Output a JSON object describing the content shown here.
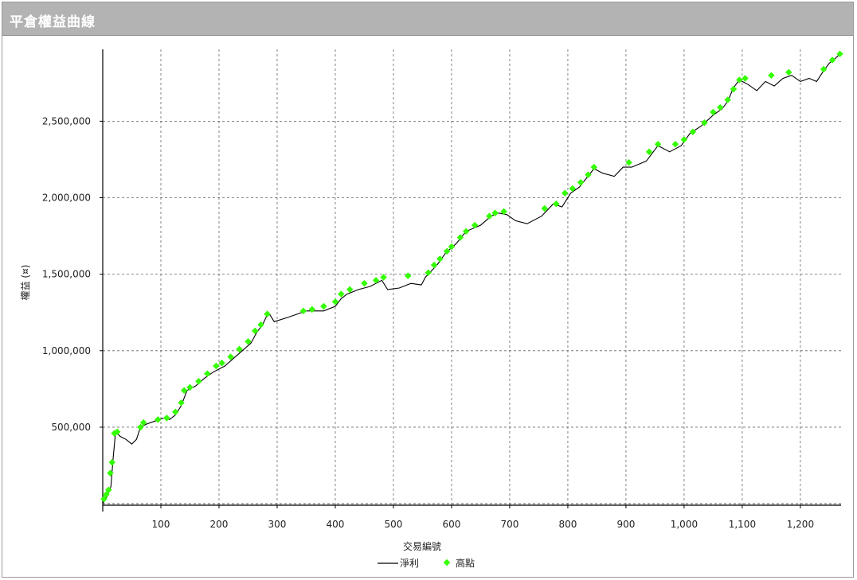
{
  "window": {
    "title": "平倉權益曲線"
  },
  "chart_data": {
    "type": "line",
    "xlabel": "交易編號",
    "ylabel": "權益 (¤)",
    "xlim": [
      0,
      1270
    ],
    "ylim": [
      -10000,
      2970000
    ],
    "x_ticks": [
      100,
      200,
      300,
      400,
      500,
      600,
      700,
      800,
      900,
      1000,
      1100,
      1200
    ],
    "x_tick_labels": [
      "100",
      "200",
      "300",
      "400",
      "500",
      "600",
      "700",
      "800",
      "900",
      "1,000",
      "1,100",
      "1,200"
    ],
    "y_ticks": [
      500000,
      1000000,
      1500000,
      2000000,
      2500000
    ],
    "y_tick_labels": [
      "500,000",
      "1,000,000",
      "1,500,000",
      "2,000,000",
      "2,500,000"
    ],
    "grid": true,
    "legend_position": "bottom-center",
    "series": [
      {
        "name": "淨利",
        "style": "line",
        "color": "#000000",
        "points": [
          [
            0,
            0
          ],
          [
            8,
            50000
          ],
          [
            14,
            110000
          ],
          [
            18,
            300000
          ],
          [
            22,
            470000
          ],
          [
            30,
            440000
          ],
          [
            40,
            420000
          ],
          [
            50,
            390000
          ],
          [
            58,
            420000
          ],
          [
            65,
            500000
          ],
          [
            75,
            520000
          ],
          [
            90,
            540000
          ],
          [
            105,
            560000
          ],
          [
            115,
            550000
          ],
          [
            125,
            580000
          ],
          [
            135,
            640000
          ],
          [
            145,
            740000
          ],
          [
            160,
            770000
          ],
          [
            175,
            820000
          ],
          [
            190,
            860000
          ],
          [
            210,
            900000
          ],
          [
            225,
            950000
          ],
          [
            240,
            1000000
          ],
          [
            255,
            1050000
          ],
          [
            265,
            1120000
          ],
          [
            275,
            1170000
          ],
          [
            285,
            1250000
          ],
          [
            295,
            1190000
          ],
          [
            320,
            1220000
          ],
          [
            350,
            1260000
          ],
          [
            380,
            1260000
          ],
          [
            400,
            1290000
          ],
          [
            410,
            1340000
          ],
          [
            420,
            1370000
          ],
          [
            440,
            1400000
          ],
          [
            460,
            1420000
          ],
          [
            480,
            1460000
          ],
          [
            490,
            1400000
          ],
          [
            510,
            1410000
          ],
          [
            530,
            1440000
          ],
          [
            548,
            1430000
          ],
          [
            555,
            1480000
          ],
          [
            575,
            1560000
          ],
          [
            590,
            1640000
          ],
          [
            608,
            1700000
          ],
          [
            625,
            1780000
          ],
          [
            650,
            1820000
          ],
          [
            668,
            1880000
          ],
          [
            680,
            1900000
          ],
          [
            695,
            1890000
          ],
          [
            710,
            1850000
          ],
          [
            730,
            1830000
          ],
          [
            755,
            1880000
          ],
          [
            775,
            1960000
          ],
          [
            790,
            1940000
          ],
          [
            805,
            2030000
          ],
          [
            820,
            2070000
          ],
          [
            845,
            2190000
          ],
          [
            860,
            2160000
          ],
          [
            880,
            2140000
          ],
          [
            895,
            2200000
          ],
          [
            910,
            2200000
          ],
          [
            935,
            2240000
          ],
          [
            955,
            2340000
          ],
          [
            975,
            2300000
          ],
          [
            995,
            2340000
          ],
          [
            1010,
            2420000
          ],
          [
            1030,
            2470000
          ],
          [
            1050,
            2540000
          ],
          [
            1065,
            2580000
          ],
          [
            1075,
            2630000
          ],
          [
            1085,
            2720000
          ],
          [
            1095,
            2770000
          ],
          [
            1110,
            2740000
          ],
          [
            1125,
            2700000
          ],
          [
            1140,
            2760000
          ],
          [
            1155,
            2730000
          ],
          [
            1170,
            2780000
          ],
          [
            1185,
            2800000
          ],
          [
            1200,
            2760000
          ],
          [
            1215,
            2780000
          ],
          [
            1228,
            2760000
          ],
          [
            1240,
            2830000
          ],
          [
            1250,
            2880000
          ],
          [
            1260,
            2910000
          ],
          [
            1268,
            2940000
          ]
        ]
      },
      {
        "name": "高點",
        "style": "markers",
        "color": "#33ff00",
        "points": [
          [
            2,
            30000
          ],
          [
            6,
            60000
          ],
          [
            10,
            90000
          ],
          [
            13,
            200000
          ],
          [
            16,
            270000
          ],
          [
            20,
            460000
          ],
          [
            25,
            470000
          ],
          [
            65,
            500000
          ],
          [
            70,
            530000
          ],
          [
            95,
            550000
          ],
          [
            110,
            560000
          ],
          [
            125,
            600000
          ],
          [
            135,
            660000
          ],
          [
            140,
            740000
          ],
          [
            150,
            760000
          ],
          [
            165,
            800000
          ],
          [
            180,
            850000
          ],
          [
            195,
            900000
          ],
          [
            205,
            920000
          ],
          [
            220,
            960000
          ],
          [
            235,
            1010000
          ],
          [
            250,
            1060000
          ],
          [
            262,
            1130000
          ],
          [
            272,
            1170000
          ],
          [
            283,
            1240000
          ],
          [
            345,
            1260000
          ],
          [
            360,
            1270000
          ],
          [
            380,
            1290000
          ],
          [
            400,
            1320000
          ],
          [
            410,
            1370000
          ],
          [
            425,
            1400000
          ],
          [
            450,
            1440000
          ],
          [
            470,
            1460000
          ],
          [
            483,
            1480000
          ],
          [
            525,
            1490000
          ],
          [
            560,
            1510000
          ],
          [
            570,
            1560000
          ],
          [
            580,
            1600000
          ],
          [
            592,
            1650000
          ],
          [
            600,
            1680000
          ],
          [
            615,
            1740000
          ],
          [
            625,
            1780000
          ],
          [
            640,
            1820000
          ],
          [
            665,
            1880000
          ],
          [
            675,
            1900000
          ],
          [
            690,
            1910000
          ],
          [
            760,
            1930000
          ],
          [
            780,
            1960000
          ],
          [
            795,
            2030000
          ],
          [
            808,
            2060000
          ],
          [
            822,
            2100000
          ],
          [
            835,
            2150000
          ],
          [
            845,
            2200000
          ],
          [
            905,
            2230000
          ],
          [
            940,
            2300000
          ],
          [
            955,
            2350000
          ],
          [
            985,
            2350000
          ],
          [
            1000,
            2380000
          ],
          [
            1015,
            2430000
          ],
          [
            1035,
            2490000
          ],
          [
            1050,
            2560000
          ],
          [
            1062,
            2590000
          ],
          [
            1075,
            2640000
          ],
          [
            1085,
            2710000
          ],
          [
            1095,
            2770000
          ],
          [
            1105,
            2780000
          ],
          [
            1150,
            2800000
          ],
          [
            1180,
            2820000
          ],
          [
            1240,
            2840000
          ],
          [
            1255,
            2900000
          ],
          [
            1268,
            2940000
          ]
        ]
      }
    ]
  }
}
